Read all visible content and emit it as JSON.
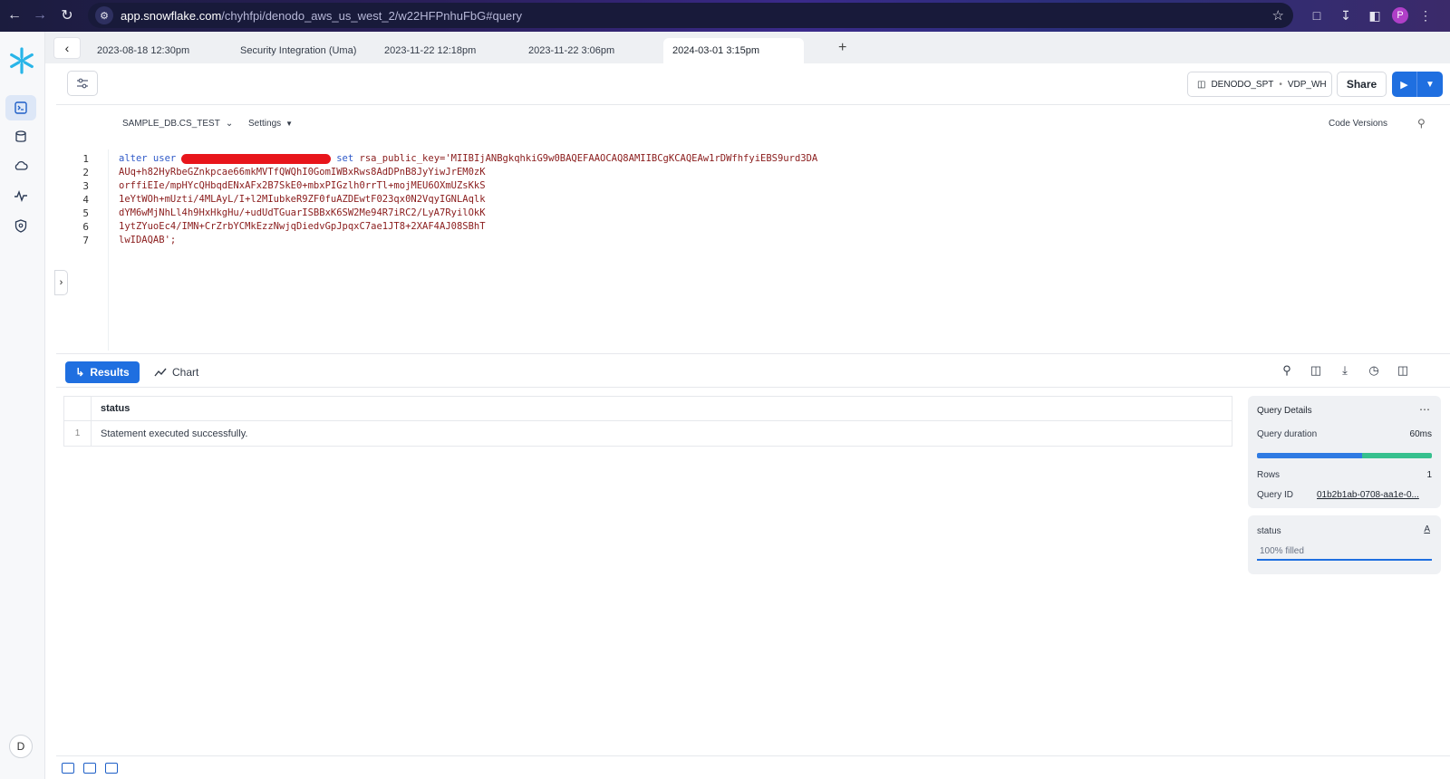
{
  "browser": {
    "url_host": "app.snowflake.com",
    "url_path": "/chyhfpi/denodo_aws_us_west_2/w22HFPnhuFbG#query",
    "profile_initial": "P"
  },
  "rail": {
    "avatar_initial": "D"
  },
  "tabs": [
    {
      "label": "2023-08-18 12:30pm"
    },
    {
      "label": "Security Integration (Uma)"
    },
    {
      "label": "2023-11-22 12:18pm"
    },
    {
      "label": "2023-11-22 3:06pm"
    },
    {
      "label": "2024-03-01 3:15pm",
      "active": true
    }
  ],
  "toolbar": {
    "role": "DENODO_SPT",
    "warehouse": "VDP_WH",
    "share_label": "Share"
  },
  "editor": {
    "database": "SAMPLE_DB.CS_TEST",
    "settings_label": "Settings",
    "code_versions_label": "Code Versions",
    "line_numbers": [
      "1",
      "2",
      "3",
      "4",
      "5",
      "6",
      "7"
    ],
    "line1_kw1": "alter user",
    "line1_kw2": "set",
    "line1_rest": " rsa_public_key='MIIBIjANBgkqhkiG9w0BAQEFAAOCAQ8AMIIBCgKCAQEAw1rDWfhfyiEBS9urd3DA",
    "lines": [
      "AUq+h82HyRbeGZnkpcae66mkMVTfQWQhI0GomIWBxRws8AdDPnB8JyYiwJrEM0zK",
      "orffiEIe/mpHYcQHbqdENxAFx2B7SkE0+mbxPIGzlh0rrTl+mojMEU6OXmUZsKkS",
      "1eYtWOh+mUzti/4MLAyL/I+l2MIubkeR9ZF0fuAZDEwtF023qx0N2VqyIGNLAqlk",
      "dYM6wMjNhLl4h9HxHkgHu/+udUdTGuarISBBxK6SW2Me94R7iRC2/LyA7RyilOkK",
      "1ytZYuoEc4/IMN+CrZrbYCMkEzzNwjqDiedvGpJpqxC7ae1JT8+2XAF4AJ08SBhT",
      "lwIDAQAB';"
    ]
  },
  "results": {
    "results_label": "Results",
    "chart_label": "Chart",
    "column": "status",
    "rows": [
      {
        "index": "1",
        "status": "Statement executed successfully."
      }
    ]
  },
  "query_details": {
    "title": "Query Details",
    "duration_label": "Query duration",
    "duration_value": "60ms",
    "duration_split": [
      0.6,
      0.4
    ],
    "rows_label": "Rows",
    "rows_value": "1",
    "query_id_label": "Query ID",
    "query_id_value": "01b2b1ab-0708-aa1e-0..."
  },
  "status_panel": {
    "title": "status",
    "type_icon": "A",
    "fill_text": "100% filled"
  },
  "colors": {
    "accent": "#1f6fe0",
    "success": "#36c08e",
    "redaction": "#e8151b"
  }
}
